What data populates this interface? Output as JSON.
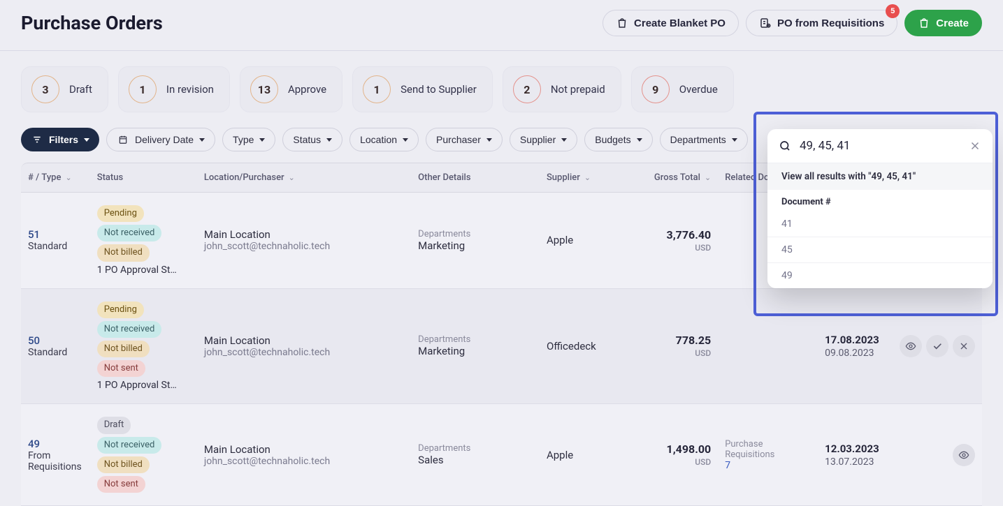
{
  "page": {
    "title": "Purchase Orders"
  },
  "header_actions": {
    "blanket": "Create Blanket PO",
    "from_req": "PO from Requisitions",
    "from_req_badge": "5",
    "create": "Create"
  },
  "cards": [
    {
      "count": "3",
      "label": "Draft",
      "style": ""
    },
    {
      "count": "1",
      "label": "In revision",
      "style": ""
    },
    {
      "count": "13",
      "label": "Approve",
      "style": ""
    },
    {
      "count": "1",
      "label": "Send to Supplier",
      "style": ""
    },
    {
      "count": "2",
      "label": "Not prepaid",
      "style": "red"
    },
    {
      "count": "9",
      "label": "Overdue",
      "style": "red"
    }
  ],
  "filters": {
    "main": "Filters",
    "chips": [
      "Delivery Date",
      "Type",
      "Status",
      "Location",
      "Purchaser",
      "Supplier",
      "Budgets",
      "Departments"
    ]
  },
  "columns": {
    "num_type": "# / Type",
    "status": "Status",
    "loc": "Location/Purchaser",
    "details": "Other Details",
    "supplier": "Supplier",
    "gross": "Gross Total",
    "reldoc": "Related Documents",
    "dates": "",
    "actions": ""
  },
  "rows": [
    {
      "num": "51",
      "type": "Standard",
      "tags": [
        {
          "text": "Pending",
          "cls": "tag-amber"
        },
        {
          "text": "Not received",
          "cls": "tag-teal"
        },
        {
          "text": "Not billed",
          "cls": "tag-beige"
        }
      ],
      "approval": "1 PO Approval St…",
      "location": "Main Location",
      "email": "john_scott@technaholic.tech",
      "dep_label": "Departments",
      "dep_value": "Marketing",
      "supplier": "Apple",
      "amount": "3,776.40",
      "currency": "USD",
      "reldoc_label": "",
      "reldoc_link": "",
      "date1": "",
      "date2": "",
      "actions": []
    },
    {
      "num": "50",
      "type": "Standard",
      "tags": [
        {
          "text": "Pending",
          "cls": "tag-amber"
        },
        {
          "text": "Not received",
          "cls": "tag-teal"
        },
        {
          "text": "Not billed",
          "cls": "tag-beige"
        },
        {
          "text": "Not sent",
          "cls": "tag-rose"
        }
      ],
      "approval": "1 PO Approval St…",
      "location": "Main Location",
      "email": "john_scott@technaholic.tech",
      "dep_label": "Departments",
      "dep_value": "Marketing",
      "supplier": "Officedeck",
      "amount": "778.25",
      "currency": "USD",
      "reldoc_label": "",
      "reldoc_link": "",
      "date1": "17.08.2023",
      "date2": "09.08.2023",
      "actions": [
        "eye",
        "check",
        "x"
      ]
    },
    {
      "num": "49",
      "type": "From Requisitions",
      "tags": [
        {
          "text": "Draft",
          "cls": "tag-gray"
        },
        {
          "text": "Not received",
          "cls": "tag-teal"
        },
        {
          "text": "Not billed",
          "cls": "tag-beige"
        },
        {
          "text": "Not sent",
          "cls": "tag-rose"
        }
      ],
      "approval": "",
      "location": "Main Location",
      "email": "john_scott@technaholic.tech",
      "dep_label": "Departments",
      "dep_value": "Sales",
      "supplier": "Apple",
      "amount": "1,498.00",
      "currency": "USD",
      "reldoc_label": "Purchase Requisitions",
      "reldoc_link": "7",
      "date1": "12.03.2023",
      "date2": "13.07.2023",
      "actions": [
        "eye"
      ]
    }
  ],
  "search": {
    "value": "49, 45, 41",
    "all_results_prefix": "View all results with ",
    "all_results_query": "\"49, 45, 41\"",
    "section": "Document #",
    "items": [
      "41",
      "45",
      "49"
    ]
  }
}
